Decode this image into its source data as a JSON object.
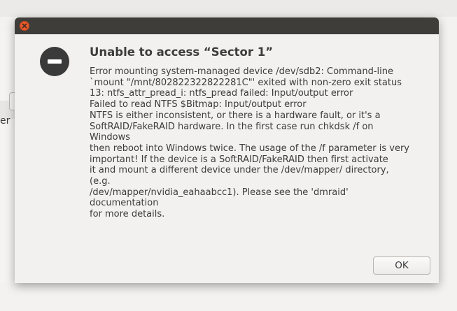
{
  "background": {
    "partial_label": "er"
  },
  "dialog": {
    "title": "Unable to access “Sector 1”",
    "message_lines": [
      "Error mounting system-managed device /dev/sdb2: Command-line",
      "`mount \"/mnt/802822322822281C\"' exited with non-zero exit status",
      "13: ntfs_attr_pread_i: ntfs_pread failed: Input/output error",
      "Failed to read NTFS $Bitmap: Input/output error",
      "NTFS is either inconsistent, or there is a hardware fault, or it's a",
      "SoftRAID/FakeRAID hardware. In the first case run chkdsk /f on",
      "Windows",
      "then reboot into Windows twice. The usage of the /f parameter is very",
      "important! If the device is a SoftRAID/FakeRAID then first activate",
      "it and mount a different device under the /dev/mapper/ directory,",
      "(e.g.",
      "/dev/mapper/nvidia_eahaabcc1). Please see the 'dmraid'",
      "documentation",
      "for more details."
    ],
    "ok_label": "OK"
  },
  "colors": {
    "titlebar": "#3f3d39",
    "close_button": "#e85a2c",
    "dialog_bg": "#f2f1f0",
    "text": "#3c3c3c"
  },
  "icons": {
    "close": "close-icon",
    "error": "error-icon"
  }
}
